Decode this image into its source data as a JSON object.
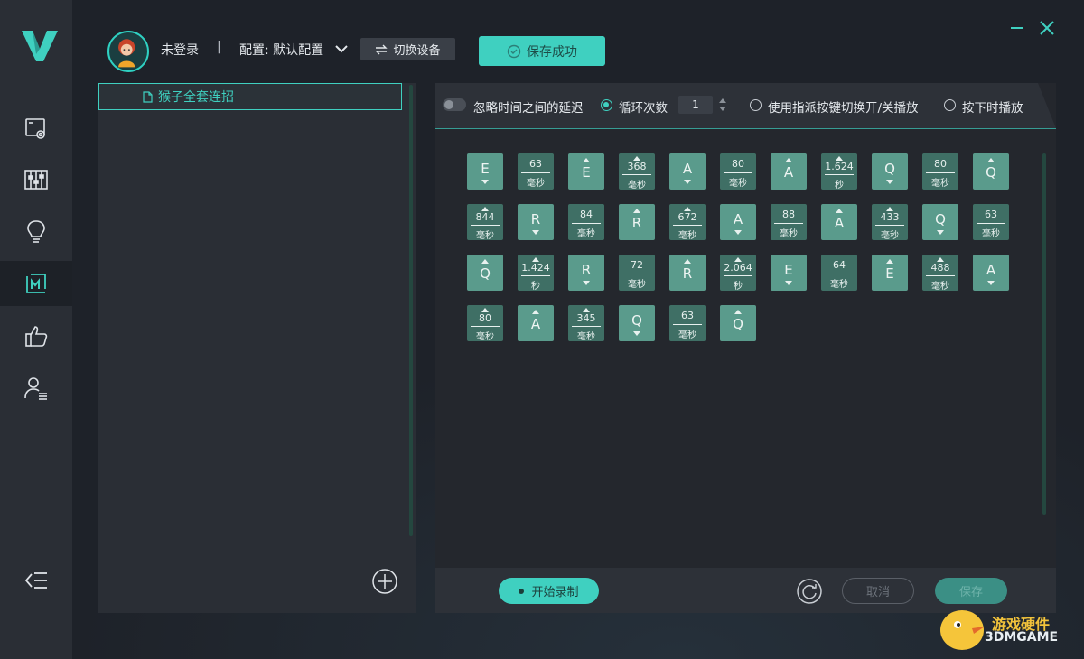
{
  "header": {
    "user_name": "未登录",
    "separator": "|",
    "config_label": "配置: 默认配置",
    "switch_device": "切换设备",
    "save_status": "保存成功"
  },
  "sidebar": {
    "items": [
      {
        "icon": "settings-screen-icon",
        "active": false
      },
      {
        "icon": "equalizer-icon",
        "active": false
      },
      {
        "icon": "lightbulb-icon",
        "active": false
      },
      {
        "icon": "macro-icon",
        "active": true
      },
      {
        "icon": "thumbs-up-icon",
        "active": false
      },
      {
        "icon": "user-list-icon",
        "active": false
      }
    ]
  },
  "macro_list": {
    "items": [
      {
        "label": "猴子全套连招",
        "selected": true
      }
    ]
  },
  "options": {
    "ignore_delay": "忽略时间之间的延迟",
    "loop_count_label": "循环次数",
    "loop_count_value": "1",
    "toggle_mode": "使用指派按键切换开/关播放",
    "hold_mode": "按下时播放"
  },
  "steps": [
    [
      {
        "type": "key",
        "key": "E",
        "dir": "down"
      },
      {
        "type": "delay",
        "value": "63",
        "unit": "毫秒"
      },
      {
        "type": "key",
        "key": "E",
        "dir": "up"
      },
      {
        "type": "delay",
        "value": "368",
        "unit": "毫秒"
      },
      {
        "type": "key",
        "key": "A",
        "dir": "down"
      },
      {
        "type": "delay",
        "value": "80",
        "unit": "毫秒"
      },
      {
        "type": "key",
        "key": "A",
        "dir": "up"
      },
      {
        "type": "delay",
        "value": "1.624",
        "unit": "秒"
      },
      {
        "type": "key",
        "key": "Q",
        "dir": "down"
      },
      {
        "type": "delay",
        "value": "80",
        "unit": "毫秒"
      },
      {
        "type": "key",
        "key": "Q",
        "dir": "up"
      }
    ],
    [
      {
        "type": "delay",
        "value": "844",
        "unit": "毫秒"
      },
      {
        "type": "key",
        "key": "R",
        "dir": "down"
      },
      {
        "type": "delay",
        "value": "84",
        "unit": "毫秒"
      },
      {
        "type": "key",
        "key": "R",
        "dir": "up"
      },
      {
        "type": "delay",
        "value": "672",
        "unit": "毫秒"
      },
      {
        "type": "key",
        "key": "A",
        "dir": "down"
      },
      {
        "type": "delay",
        "value": "88",
        "unit": "毫秒"
      },
      {
        "type": "key",
        "key": "A",
        "dir": "up"
      },
      {
        "type": "delay",
        "value": "433",
        "unit": "毫秒"
      },
      {
        "type": "key",
        "key": "Q",
        "dir": "down"
      },
      {
        "type": "delay",
        "value": "63",
        "unit": "毫秒"
      }
    ],
    [
      {
        "type": "key",
        "key": "Q",
        "dir": "up"
      },
      {
        "type": "delay",
        "value": "1.424",
        "unit": "秒"
      },
      {
        "type": "key",
        "key": "R",
        "dir": "down"
      },
      {
        "type": "delay",
        "value": "72",
        "unit": "毫秒"
      },
      {
        "type": "key",
        "key": "R",
        "dir": "up"
      },
      {
        "type": "delay",
        "value": "2.064",
        "unit": "秒"
      },
      {
        "type": "key",
        "key": "E",
        "dir": "down"
      },
      {
        "type": "delay",
        "value": "64",
        "unit": "毫秒"
      },
      {
        "type": "key",
        "key": "E",
        "dir": "up"
      },
      {
        "type": "delay",
        "value": "488",
        "unit": "毫秒"
      },
      {
        "type": "key",
        "key": "A",
        "dir": "down"
      }
    ],
    [
      {
        "type": "delay",
        "value": "80",
        "unit": "毫秒"
      },
      {
        "type": "key",
        "key": "A",
        "dir": "up"
      },
      {
        "type": "delay",
        "value": "345",
        "unit": "毫秒"
      },
      {
        "type": "key",
        "key": "Q",
        "dir": "down"
      },
      {
        "type": "delay",
        "value": "63",
        "unit": "毫秒"
      },
      {
        "type": "key",
        "key": "Q",
        "dir": "up"
      }
    ]
  ],
  "bottom": {
    "record": "开始录制",
    "cancel": "取消",
    "save": "保存"
  },
  "watermark": {
    "line1": "游戏硬件",
    "line2": "3DMGAME"
  },
  "colors": {
    "accent": "#3fd0c0",
    "key_tile": "#5a9b8c",
    "delay_tile": "#3f6f65",
    "panel": "#2a2e35"
  }
}
